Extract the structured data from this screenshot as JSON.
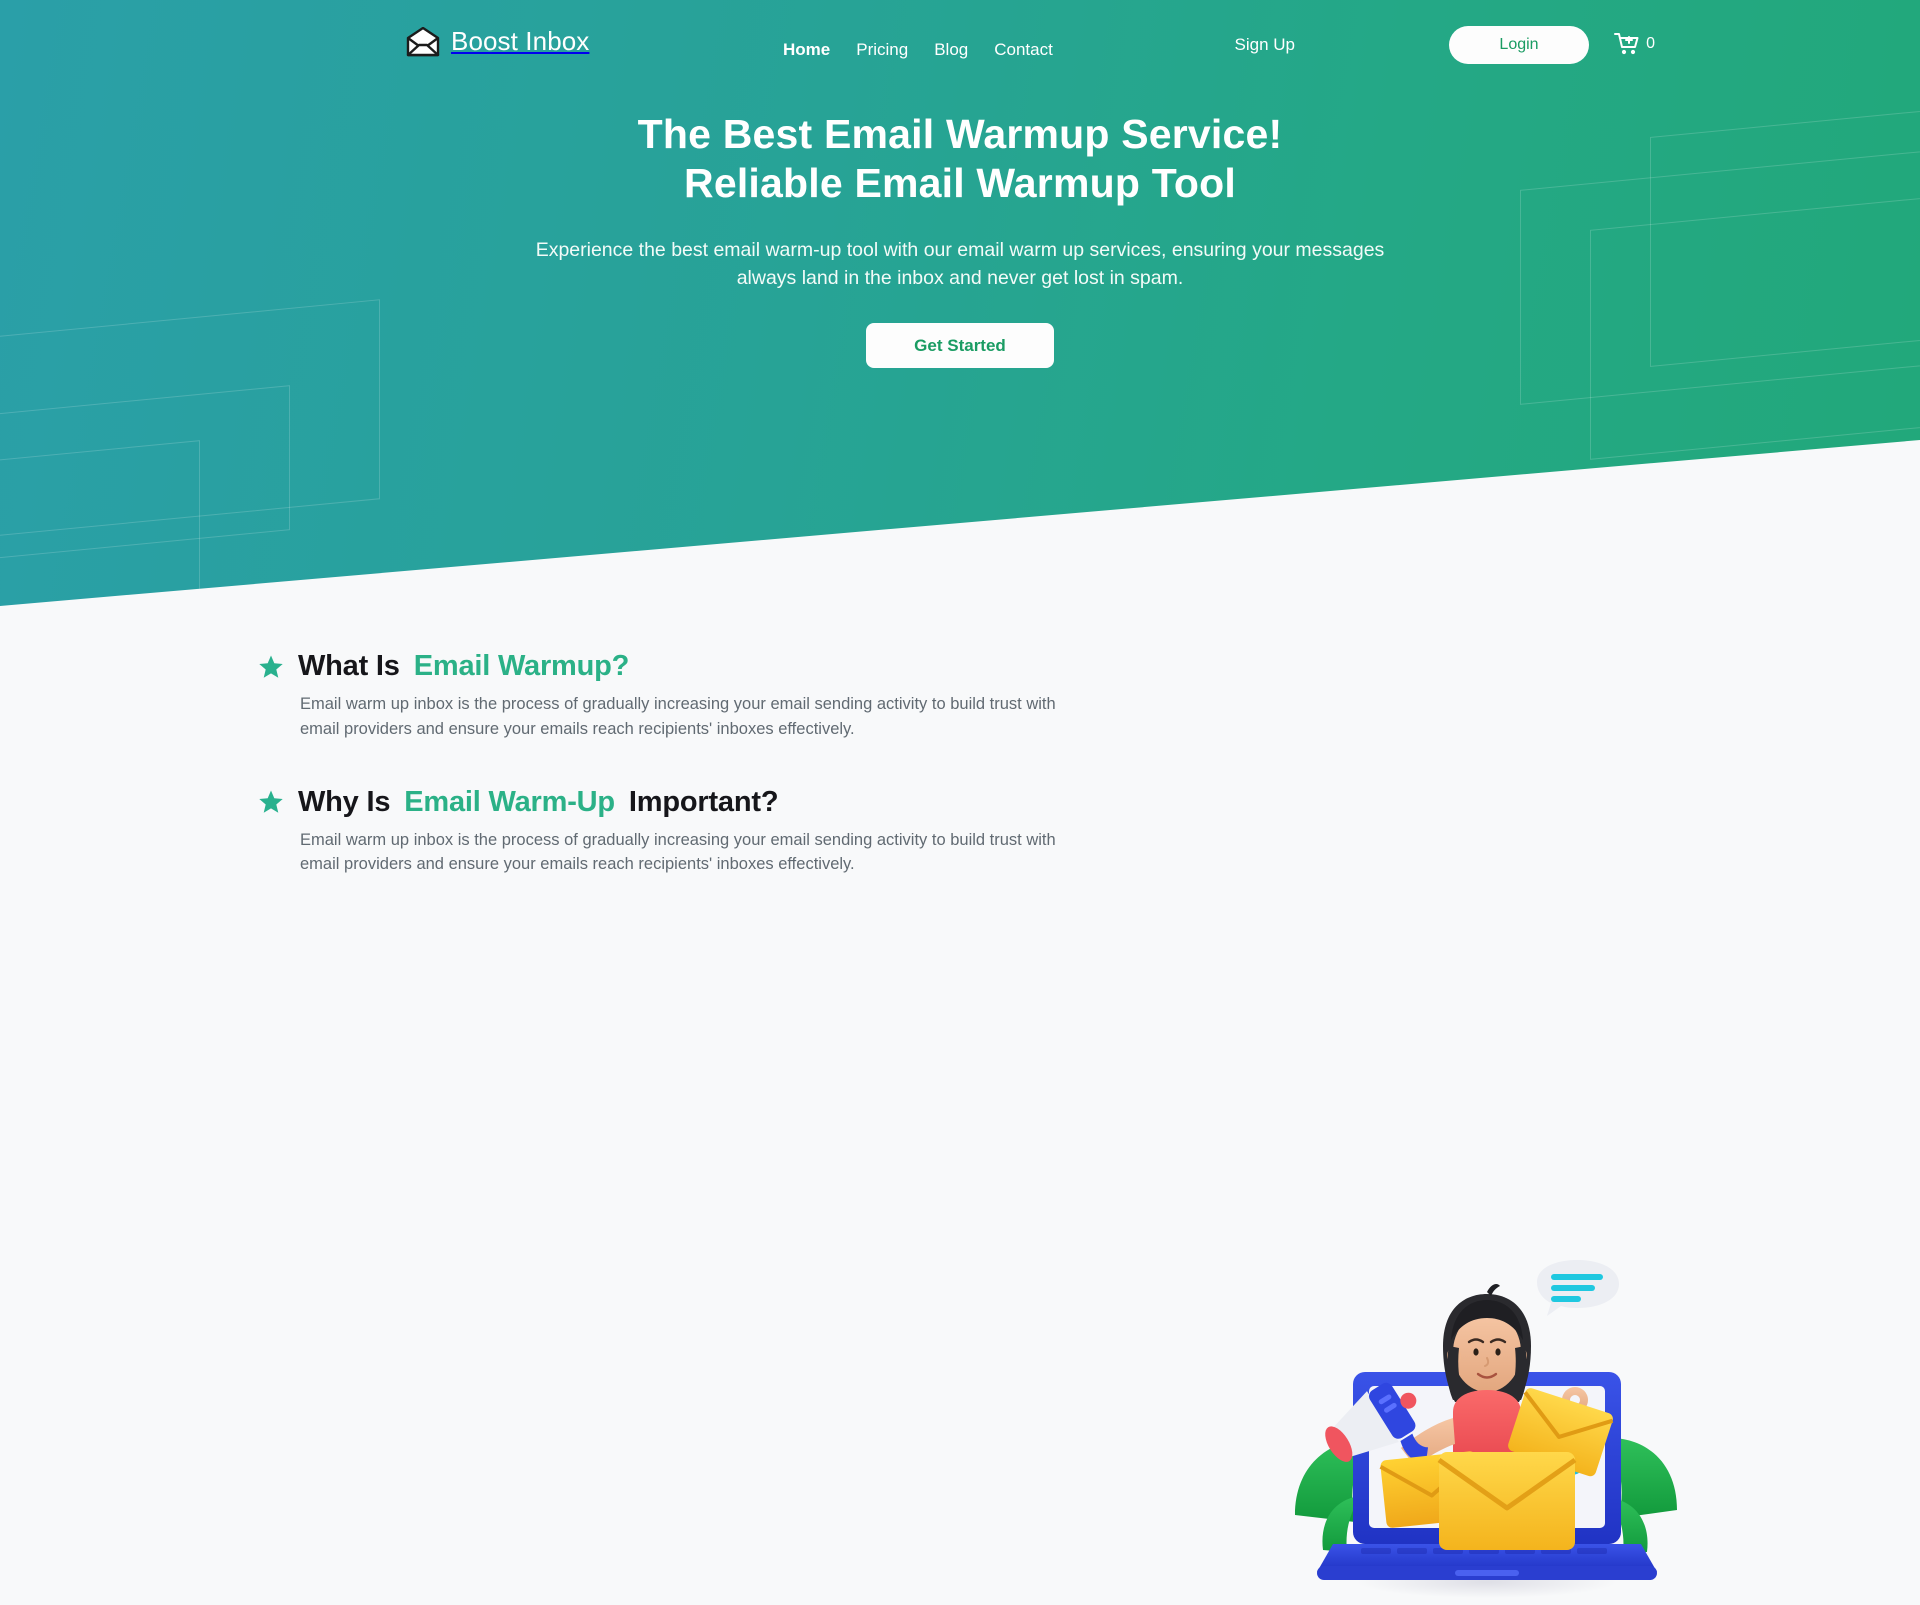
{
  "brand": {
    "name": "Boost Inbox",
    "logo_icon": "open-envelope-icon",
    "colors": {
      "hero_gradient_start": "#2a9fa8",
      "hero_gradient_end": "#22a87a",
      "accent_green": "#2bb187",
      "button_text_green": "#1a9c63",
      "heading_dark": "#16161a",
      "body_gray": "#616a72",
      "page_background": "#f8f9fa"
    }
  },
  "header": {
    "nav": [
      {
        "label": "Home",
        "active": true
      },
      {
        "label": "Pricing",
        "active": false
      },
      {
        "label": "Blog",
        "active": false
      },
      {
        "label": "Contact",
        "active": false
      }
    ],
    "signup_label": "Sign Up",
    "login_label": "Login",
    "cart_icon": "cart-plus-icon",
    "cart_count": "0"
  },
  "hero": {
    "headline_line1": "The Best Email Warmup Service!",
    "headline_line2": "Reliable Email Warmup Tool",
    "subtitle": "Experience the best email warm-up tool with our email warm up services, ensuring your messages always land in the inbox and never get lost in spam.",
    "cta_label": "Get Started"
  },
  "info": {
    "blocks": [
      {
        "bullet_icon": "star-icon",
        "heading_pre": "What Is ",
        "heading_accent": "Email Warmup?",
        "heading_post": "",
        "body": "Email warm up inbox is the process of gradually increasing your email sending activity to build trust with email providers and ensure your emails reach recipients' inboxes effectively."
      },
      {
        "bullet_icon": "star-icon",
        "heading_pre": "Why Is ",
        "heading_accent": "Email Warm-Up",
        "heading_post": " Important?",
        "body": "Email warm up inbox is the process of gradually increasing your email sending activity to build trust with email providers and ensure your emails reach recipients' inboxes effectively."
      }
    ],
    "illustration": "woman-megaphone-laptop-email-illustration"
  }
}
